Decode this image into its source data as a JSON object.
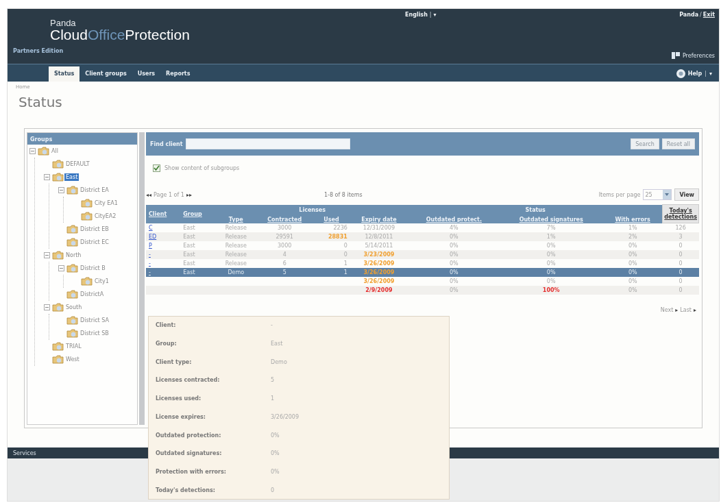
{
  "header": {
    "brand_top": "Panda",
    "brand_parts": [
      {
        "text": "Cloud",
        "kind": "strong"
      },
      {
        "text": "Office",
        "kind": "light"
      },
      {
        "text": "Protection",
        "kind": "strong"
      }
    ],
    "edition": "Partners Edition",
    "language": "English",
    "language_sep": "|",
    "language_caret": "▾",
    "user": "Panda",
    "user_sep": "/",
    "exit_link": "Exit",
    "preferences": "Preferences"
  },
  "nav": {
    "tabs": [
      {
        "label": "Status",
        "selected": true
      },
      {
        "label": "Client groups",
        "selected": false
      },
      {
        "label": "Users",
        "selected": false
      },
      {
        "label": "Reports",
        "selected": false
      }
    ],
    "help": "Help",
    "help_sep": "|",
    "help_caret": "▾"
  },
  "breadcrumb": "Home",
  "page_title": "Status",
  "groups": {
    "title": "Groups",
    "tree": [
      {
        "label": "All",
        "expanded": true,
        "selected": false,
        "children": [
          {
            "label": "DEFAULT",
            "selected": false
          },
          {
            "label": "East",
            "expanded": true,
            "selected": true,
            "children": [
              {
                "label": "District EA",
                "expanded": true,
                "selected": false,
                "children": [
                  {
                    "label": "City EA1",
                    "selected": false
                  },
                  {
                    "label": "CityEA2",
                    "selected": false
                  }
                ]
              },
              {
                "label": "District EB",
                "selected": false
              },
              {
                "label": "District EC",
                "selected": false
              }
            ]
          },
          {
            "label": "North",
            "expanded": true,
            "selected": false,
            "children": [
              {
                "label": "District B",
                "expanded": true,
                "selected": false,
                "children": [
                  {
                    "label": "City1",
                    "selected": false
                  }
                ]
              },
              {
                "label": "DistrictA",
                "selected": false
              }
            ]
          },
          {
            "label": "South",
            "expanded": true,
            "selected": false,
            "children": [
              {
                "label": "District SA",
                "selected": false
              },
              {
                "label": "District SB",
                "selected": false
              }
            ]
          },
          {
            "label": "TRIAL",
            "selected": false
          },
          {
            "label": "West",
            "selected": false
          }
        ]
      }
    ]
  },
  "find": {
    "label": "Find client",
    "search_button": "Search",
    "reset_button": "Reset all",
    "subgroups": {
      "label": "Show content of subgroups",
      "checked": true
    }
  },
  "pager": {
    "first": "◂◂",
    "page": "Page 1 of 1",
    "last": "▸▸",
    "count": "1-8 of 8 items",
    "per_page_label": "Items per page",
    "per_page": "25",
    "view_button": "View",
    "next": "Next",
    "next_arrow": "▸",
    "last_link": "Last",
    "last_arrow": "▸"
  },
  "table": {
    "group_headers": {
      "licenses": "Licenses",
      "status": "Status"
    },
    "columns": [
      "Client",
      "Group",
      "Type",
      "Contracted",
      "Used",
      "Expiry date",
      "Outdated protect.",
      "Outdated signatures",
      "With errors",
      "Today's detections"
    ],
    "rows": [
      {
        "selected": false,
        "cells": [
          "C",
          "East",
          "Release",
          "3000",
          "2236",
          "12/31/2009",
          "4%",
          "7%",
          "1%",
          "126"
        ]
      },
      {
        "selected": false,
        "cells": [
          "ED",
          "East",
          "Release",
          "29591",
          {
            "text": "28831",
            "color": "#f0a030"
          },
          "12/8/2011",
          "0%",
          "1%",
          "2%",
          "3"
        ]
      },
      {
        "selected": false,
        "cells": [
          "P",
          "East",
          "Release",
          "3000",
          "0",
          "5/14/2011",
          "0%",
          "0%",
          "0%",
          "0"
        ]
      },
      {
        "selected": false,
        "cells": [
          "-",
          "East",
          "Release",
          "4",
          "0",
          {
            "text": "3/23/2009",
            "color": "#f0a030"
          },
          "0%",
          "0%",
          "0%",
          "0"
        ]
      },
      {
        "selected": false,
        "cells": [
          "-",
          "East",
          "Release",
          "6",
          "1",
          {
            "text": "3/26/2009",
            "color": "#f0a030"
          },
          "0%",
          "0%",
          "0%",
          "0"
        ]
      },
      {
        "selected": true,
        "cells": [
          "-",
          "East",
          "Demo",
          "5",
          "1",
          {
            "text": "3/26/2009",
            "color": "#f0a030"
          },
          "0%",
          "0%",
          "0%",
          "0"
        ]
      },
      {
        "selected": false,
        "cells": [
          {
            "text": "3/26/2009",
            "color": "#f0a030"
          },
          "0%",
          "0%",
          "0%",
          "0"
        ]
      },
      {
        "selected": false,
        "cells": [
          {
            "text": "2/9/2009",
            "color": "#e53030"
          },
          "0%",
          {
            "text": "100%",
            "color": "#e53030"
          },
          "0%",
          "0"
        ]
      }
    ]
  },
  "tooltip": [
    {
      "label": "Client:",
      "value": "-"
    },
    {
      "label": "Group:",
      "value": "East"
    },
    {
      "label": "Client type:",
      "value": "Demo"
    },
    {
      "label": "Licenses contracted:",
      "value": "5"
    },
    {
      "label": "Licenses used:",
      "value": "1"
    },
    {
      "label": "License expires:",
      "value": "3/26/2009"
    },
    {
      "label": "Outdated protection:",
      "value": "0%"
    },
    {
      "label": "Outdated signatures:",
      "value": "0%"
    },
    {
      "label": "Protection with errors:",
      "value": "0%"
    },
    {
      "label": "Today's detections:",
      "value": "0"
    }
  ],
  "footer": {
    "label": "Services"
  }
}
